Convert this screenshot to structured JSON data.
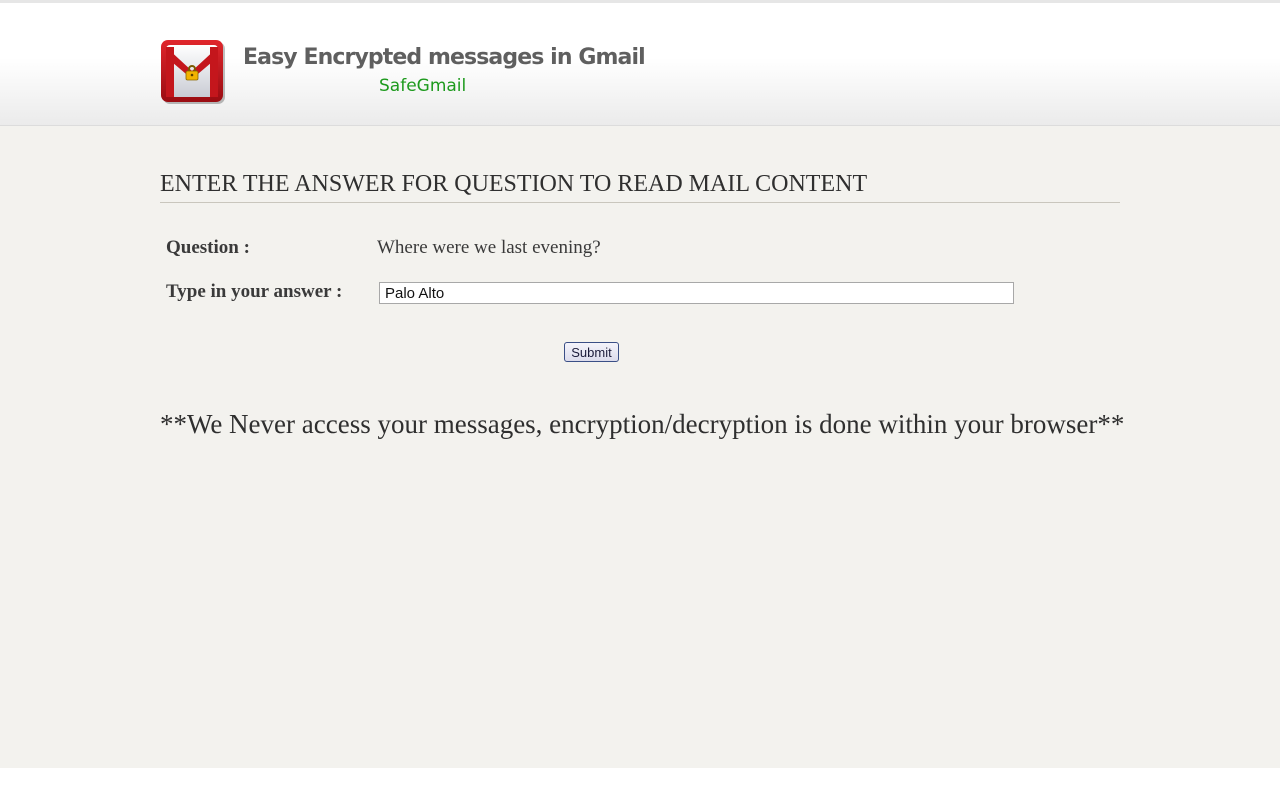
{
  "header": {
    "title": "Easy Encrypted messages in Gmail",
    "subtitle": "SafeGmail",
    "logo_icon": "gmail-envelope-lock-icon"
  },
  "main": {
    "heading": "ENTER THE ANSWER FOR QUESTION TO READ MAIL CONTENT",
    "question_label": "Question :",
    "question_text": "Where were we last evening?",
    "answer_label": "Type in your answer :",
    "answer_value": "Palo Alto",
    "submit_label": "Submit",
    "notice": "**We Never access your messages, encryption/decryption is done within your browser**"
  },
  "colors": {
    "background": "#f3f2ee",
    "subtitle_green": "#1d9a1d",
    "logo_red": "#c4161c",
    "lock_gold": "#f2b300"
  }
}
